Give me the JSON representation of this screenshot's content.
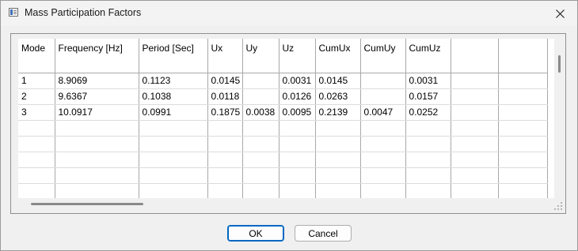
{
  "window": {
    "title": "Mass Participation Factors",
    "icon": "app-table-icon",
    "close_icon": "close-icon"
  },
  "table": {
    "columns": [
      "Mode",
      "Frequency [Hz]",
      "Period [Sec]",
      "Ux",
      "Uy",
      "Uz",
      "CumUx",
      "CumUy",
      "CumUz",
      "",
      ""
    ],
    "rows": [
      [
        "1",
        "8.9069",
        "0.1123",
        "0.0145",
        "",
        "0.0031",
        "0.0145",
        "",
        "0.0031",
        "",
        ""
      ],
      [
        "2",
        "9.6367",
        "0.1038",
        "0.0118",
        "",
        "0.0126",
        "0.0263",
        "",
        "0.0157",
        "",
        ""
      ],
      [
        "3",
        "10.0917",
        "0.0991",
        "0.1875",
        "0.0038",
        "0.0095",
        "0.2139",
        "0.0047",
        "0.0252",
        "",
        ""
      ],
      [
        "",
        "",
        "",
        "",
        "",
        "",
        "",
        "",
        "",
        "",
        ""
      ],
      [
        "",
        "",
        "",
        "",
        "",
        "",
        "",
        "",
        "",
        "",
        ""
      ],
      [
        "",
        "",
        "",
        "",
        "",
        "",
        "",
        "",
        "",
        "",
        ""
      ],
      [
        "",
        "",
        "",
        "",
        "",
        "",
        "",
        "",
        "",
        "",
        ""
      ],
      [
        "",
        "",
        "",
        "",
        "",
        "",
        "",
        "",
        "",
        "",
        ""
      ]
    ]
  },
  "buttons": {
    "ok": "OK",
    "cancel": "Cancel"
  }
}
